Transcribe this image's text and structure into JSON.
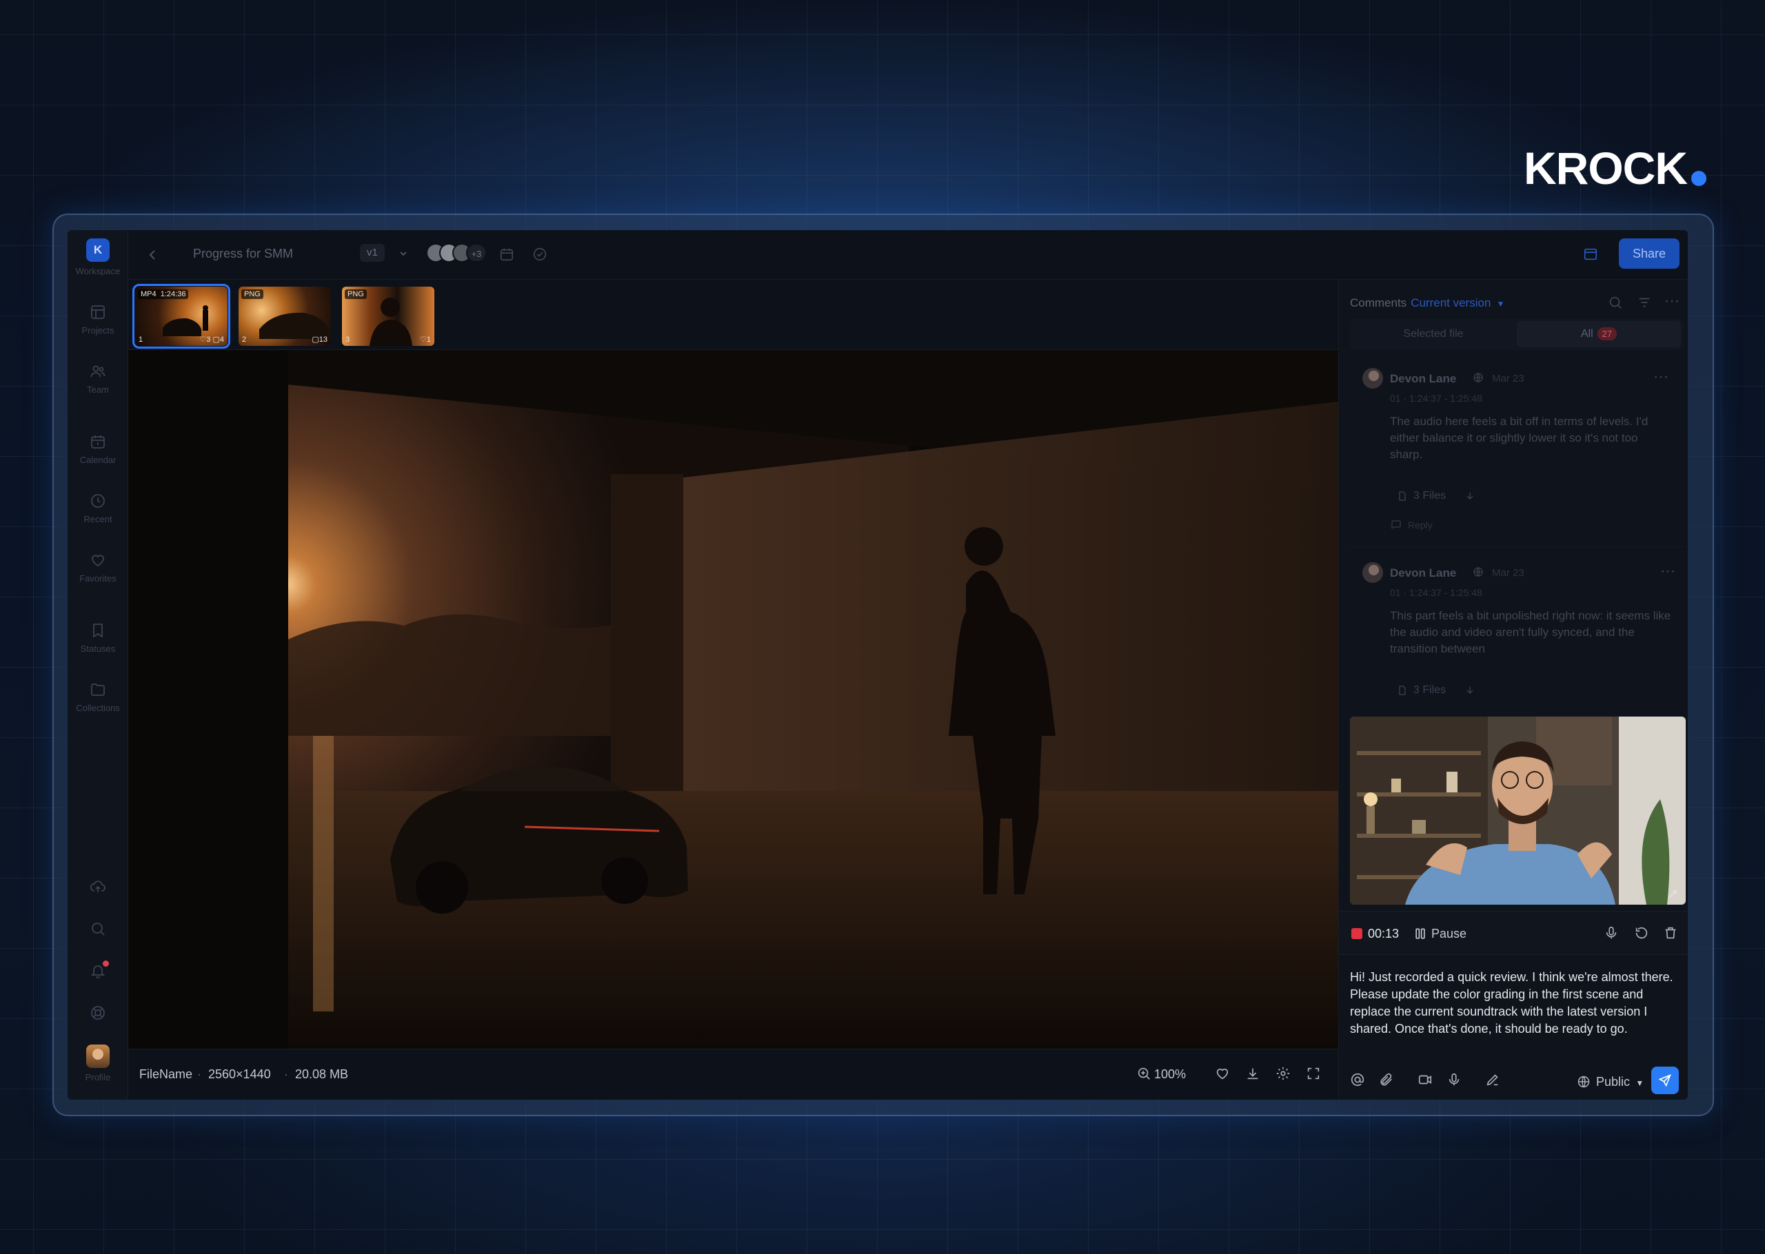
{
  "brand": {
    "name": "KROCK",
    "accent": "#2d7bff"
  },
  "sidebar": {
    "workspace_badge": "K",
    "items": [
      {
        "icon": "workspace-icon",
        "label": "Workspace"
      },
      {
        "icon": "projects-icon",
        "label": "Projects"
      },
      {
        "icon": "team-icon",
        "label": "Team"
      },
      {
        "icon": "calendar-icon",
        "label": "Calendar"
      },
      {
        "icon": "recent-icon",
        "label": "Recent"
      },
      {
        "icon": "heart-icon",
        "label": "Favorites"
      },
      {
        "icon": "bookmark-icon",
        "label": "Statuses"
      },
      {
        "icon": "folder-icon",
        "label": "Collections"
      }
    ],
    "bottom": [
      {
        "icon": "upload-icon"
      },
      {
        "icon": "search-icon"
      },
      {
        "icon": "bell-icon"
      },
      {
        "icon": "help-icon"
      },
      {
        "icon": "profile-avatar",
        "label": "Profile"
      }
    ]
  },
  "topbar": {
    "title": "Progress for SMM",
    "version": "v1",
    "more_collaborators": "+3",
    "share_label": "Share"
  },
  "thumbnails": [
    {
      "type": "MP4",
      "duration": "1:24:36",
      "index": "1",
      "likes": "3",
      "comments": "4",
      "selected": true
    },
    {
      "type": "PNG",
      "index": "2",
      "comments": "13",
      "selected": false
    },
    {
      "type": "PNG",
      "index": "3",
      "likes": "1",
      "selected": false
    }
  ],
  "file_info": {
    "name": "FileName",
    "dimensions": "2560×1440",
    "size": "20.08 MB",
    "zoom": "100%"
  },
  "comments_panel": {
    "title": "Comments",
    "version_filter": "Current version",
    "tabs": {
      "selected_file": "Selected file",
      "all": "All",
      "all_count": "27"
    },
    "comments": [
      {
        "author": "Devon Lane",
        "date": "Mar 23",
        "range": "01 · 1:24:37 - 1:25:48",
        "text": "The audio here feels a bit off in terms of levels. I'd either balance it or slightly lower it so it's not too sharp.",
        "files": "3 Files",
        "reply": "Reply"
      },
      {
        "author": "Devon Lane",
        "date": "Mar 23",
        "range": "01 · 1:24:37 - 1:25:48",
        "text": "This part feels a bit unpolished right now: it seems like the audio and video aren't fully synced, and the transition between",
        "files": "3 Files"
      }
    ],
    "recording": {
      "time": "00:13",
      "pause_label": "Pause"
    },
    "draft_message": "Hi! Just recorded a quick review. I think we're almost there. Please update the color grading in the first scene and replace the current soundtrack with the latest version I shared. Once that's done, it should be ready to go.",
    "visibility": "Public"
  },
  "colors": {
    "accent": "#2a7cf4",
    "record": "#e3323f",
    "panel_bg": "#0f131b"
  }
}
